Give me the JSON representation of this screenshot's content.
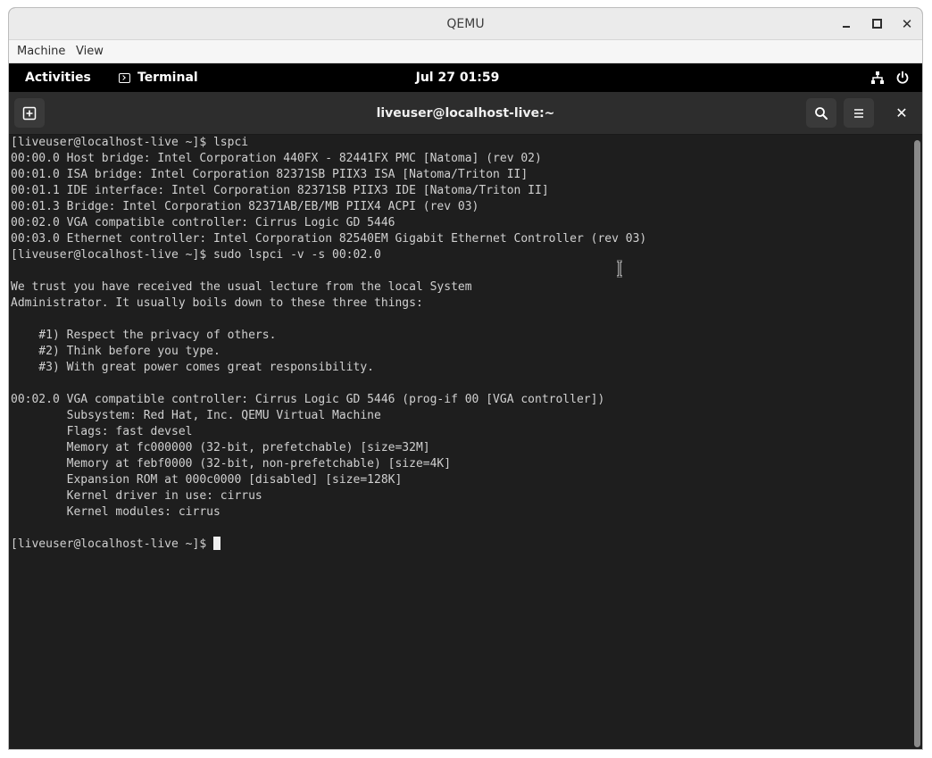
{
  "qemu": {
    "title": "QEMU",
    "menu": [
      "Machine",
      "View"
    ]
  },
  "gnome": {
    "activities": "Activities",
    "app_name": "Terminal",
    "clock": "Jul 27  01:59"
  },
  "terminal": {
    "title": "liveuser@localhost-live:~",
    "lines": [
      "[liveuser@localhost-live ~]$ lspci",
      "00:00.0 Host bridge: Intel Corporation 440FX - 82441FX PMC [Natoma] (rev 02)",
      "00:01.0 ISA bridge: Intel Corporation 82371SB PIIX3 ISA [Natoma/Triton II]",
      "00:01.1 IDE interface: Intel Corporation 82371SB PIIX3 IDE [Natoma/Triton II]",
      "00:01.3 Bridge: Intel Corporation 82371AB/EB/MB PIIX4 ACPI (rev 03)",
      "00:02.0 VGA compatible controller: Cirrus Logic GD 5446",
      "00:03.0 Ethernet controller: Intel Corporation 82540EM Gigabit Ethernet Controller (rev 03)",
      "[liveuser@localhost-live ~]$ sudo lspci -v -s 00:02.0",
      "",
      "We trust you have received the usual lecture from the local System",
      "Administrator. It usually boils down to these three things:",
      "",
      "    #1) Respect the privacy of others.",
      "    #2) Think before you type.",
      "    #3) With great power comes great responsibility.",
      "",
      "00:02.0 VGA compatible controller: Cirrus Logic GD 5446 (prog-if 00 [VGA controller])",
      "        Subsystem: Red Hat, Inc. QEMU Virtual Machine",
      "        Flags: fast devsel",
      "        Memory at fc000000 (32-bit, prefetchable) [size=32M]",
      "        Memory at febf0000 (32-bit, non-prefetchable) [size=4K]",
      "        Expansion ROM at 000c0000 [disabled] [size=128K]",
      "        Kernel driver in use: cirrus",
      "        Kernel modules: cirrus",
      ""
    ],
    "prompt": "[liveuser@localhost-live ~]$ "
  },
  "icons": {
    "minimize": "minimize-icon",
    "maximize": "maximize-icon",
    "close": "close-icon",
    "new_tab": "new-tab-icon",
    "search": "search-icon",
    "menu": "hamburger-menu-icon",
    "network": "network-icon",
    "power": "power-icon"
  },
  "colors": {
    "terminal_bg": "#1e1e1e",
    "terminal_fg": "#d0d0d0",
    "gnome_bar": "#000000",
    "header_bg": "#2d2d2d"
  }
}
